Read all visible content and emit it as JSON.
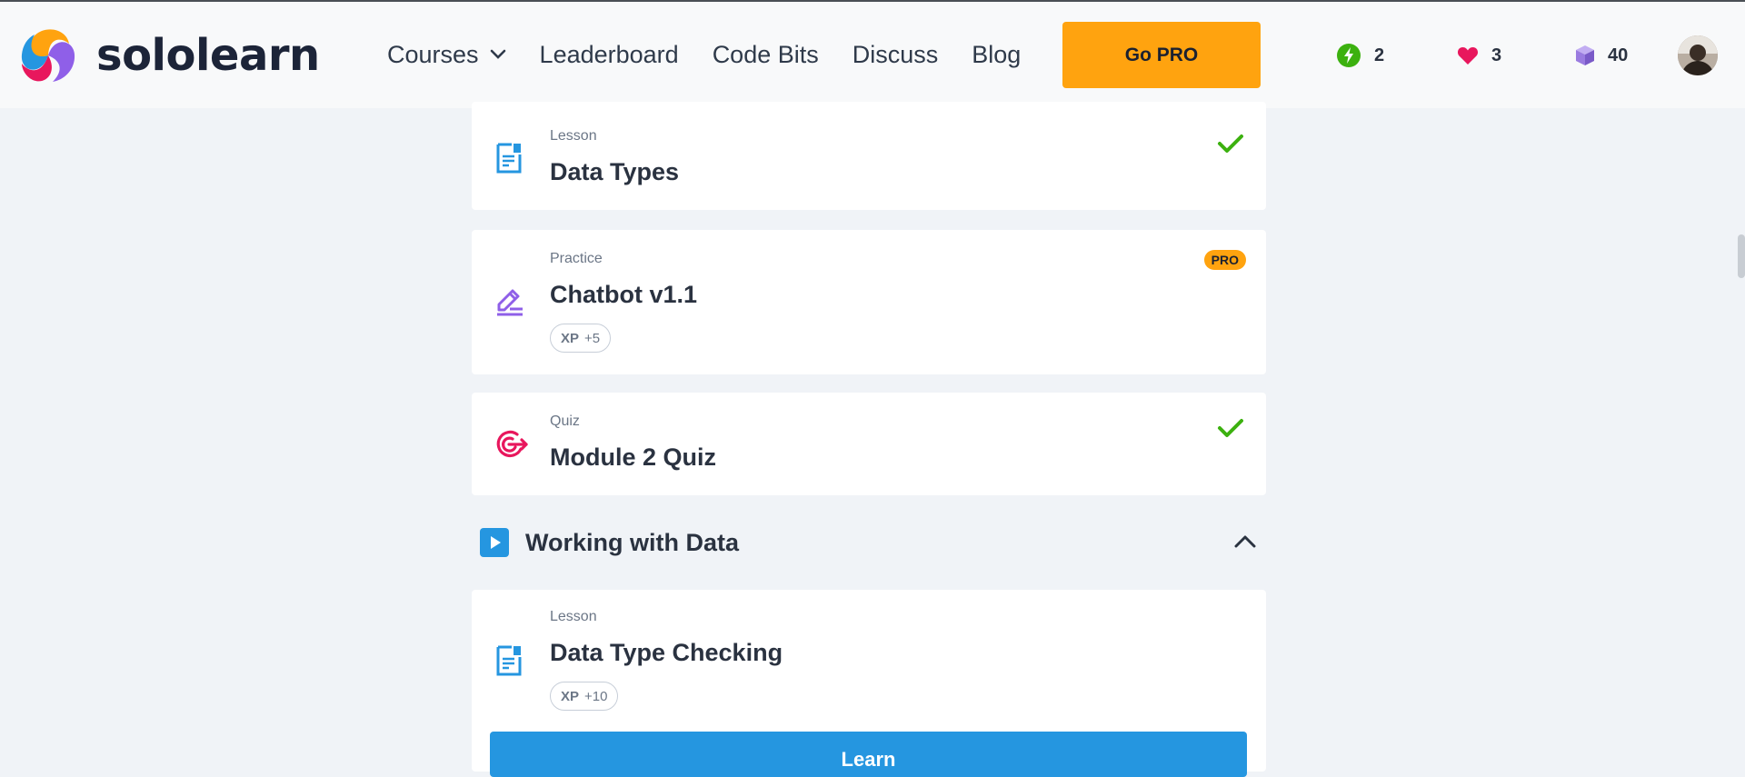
{
  "brand": {
    "name": "sololearn",
    "colors": {
      "orange": "#ffa30f",
      "pink": "#e8175d",
      "purple": "#8f5fe8",
      "blue": "#2596e0",
      "navy": "#1c2438"
    }
  },
  "nav": {
    "items": [
      {
        "label": "Courses",
        "has_dropdown": true
      },
      {
        "label": "Leaderboard"
      },
      {
        "label": "Code Bits"
      },
      {
        "label": "Discuss"
      },
      {
        "label": "Blog"
      }
    ],
    "go_pro_label": "Go PRO"
  },
  "stats": {
    "streak": {
      "icon": "lightning-icon",
      "value": "2",
      "color": "#3cb10f"
    },
    "hearts": {
      "icon": "heart-icon",
      "value": "3",
      "color": "#e8175d"
    },
    "gems": {
      "icon": "cube-icon",
      "value": "40",
      "color": "#9a7be0"
    }
  },
  "items": [
    {
      "type": "Lesson",
      "title": "Data Types",
      "status": "completed",
      "icon": "lesson-icon"
    },
    {
      "type": "Practice",
      "title": "Chatbot v1.1",
      "badge": "PRO",
      "xp_label": "XP",
      "xp_value": "+5",
      "icon": "practice-pencil-icon"
    },
    {
      "type": "Quiz",
      "title": "Module 2 Quiz",
      "status": "completed",
      "icon": "quiz-target-icon"
    }
  ],
  "section": {
    "title": "Working with Data",
    "expanded": true
  },
  "section_items": [
    {
      "type": "Lesson",
      "title": "Data Type Checking",
      "xp_label": "XP",
      "xp_value": "+10",
      "icon": "lesson-icon",
      "action_label": "Learn"
    }
  ]
}
